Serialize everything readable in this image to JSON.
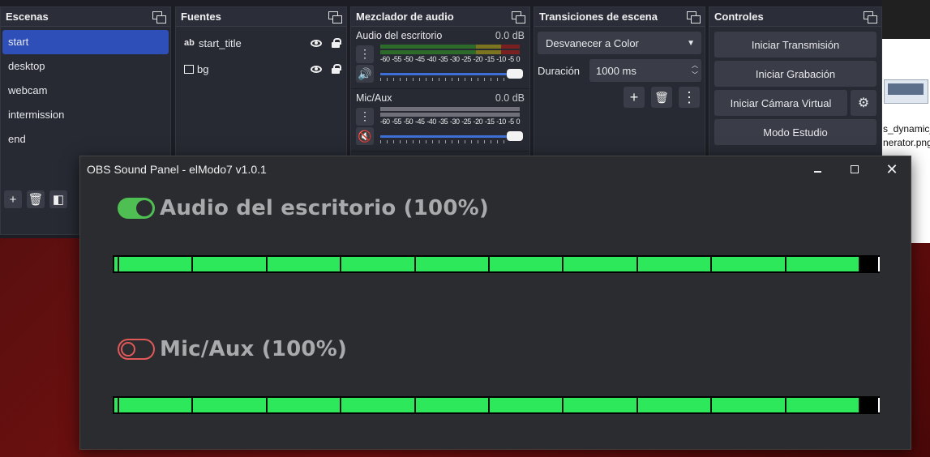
{
  "docks": {
    "scenes": {
      "title": "Escenas",
      "items": [
        "start",
        "desktop",
        "webcam",
        "intermission",
        "end"
      ],
      "active": 0
    },
    "sources": {
      "title": "Fuentes",
      "items": [
        {
          "type_label": "ab",
          "name": "start_title"
        },
        {
          "name": "bg"
        }
      ]
    },
    "mixer": {
      "title": "Mezclador de audio",
      "channels": [
        {
          "name": "Audio del escritorio",
          "db": "0.0 dB"
        },
        {
          "name": "Mic/Aux",
          "db": "0.0 dB"
        }
      ],
      "ticks": [
        "-60",
        "-55",
        "-50",
        "-45",
        "-40",
        "-35",
        "-30",
        "-25",
        "-20",
        "-15",
        "-10",
        "-5",
        "0"
      ]
    },
    "transitions": {
      "title": "Transiciones de escena",
      "selected": "Desvanecer a Color",
      "duration_label": "Duración",
      "duration_value": "1000 ms"
    },
    "controls": {
      "title": "Controles",
      "start_stream": "Iniciar Transmisión",
      "start_record": "Iniciar Grabación",
      "virtual_cam": "Iniciar Cámara Virtual",
      "studio_mode": "Modo Estudio"
    }
  },
  "desktop": {
    "filename_line1": "s_dynamic_",
    "filename_line2": "nerator.png"
  },
  "panel": {
    "title": "OBS Sound Panel - elModo7 v1.0.1",
    "sources": [
      {
        "label": "Audio del escritorio (100%)",
        "enabled": true,
        "level": 1.0
      },
      {
        "label": "Mic/Aux (100%)",
        "enabled": false,
        "level": 1.0
      }
    ]
  }
}
